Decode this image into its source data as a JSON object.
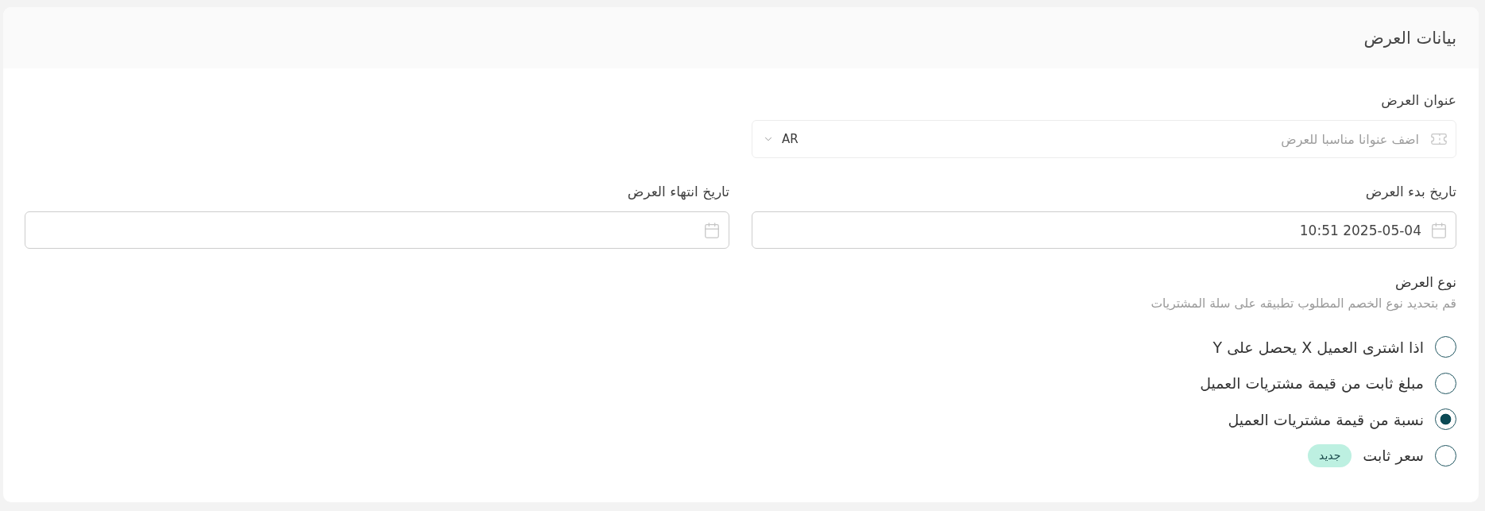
{
  "card": {
    "title": "بيانات العرض"
  },
  "offer_title": {
    "label": "عنوان العرض",
    "placeholder": "اضف عنوانا مناسبا للعرض",
    "language": "AR"
  },
  "dates": [
    {
      "label": "تاريخ بدء العرض",
      "value": "10:51 2025-05-04"
    },
    {
      "label": "تاريخ انتهاء العرض"
    }
  ],
  "offer_type": {
    "title": "نوع العرض",
    "description": "قم بتحديد نوع الخصم المطلوب تطبيقه على سلة المشتريات",
    "options": [
      {
        "label": "اذا اشترى العميل X يحصل على Y",
        "selected": false
      },
      {
        "label": "مبلغ ثابت من قيمة مشتريات العميل",
        "selected": false
      },
      {
        "label": "نسبة من قيمة مشتريات العميل",
        "selected": true
      },
      {
        "label": "سعر ثابت",
        "selected": false,
        "badge": "جديد"
      }
    ]
  }
}
